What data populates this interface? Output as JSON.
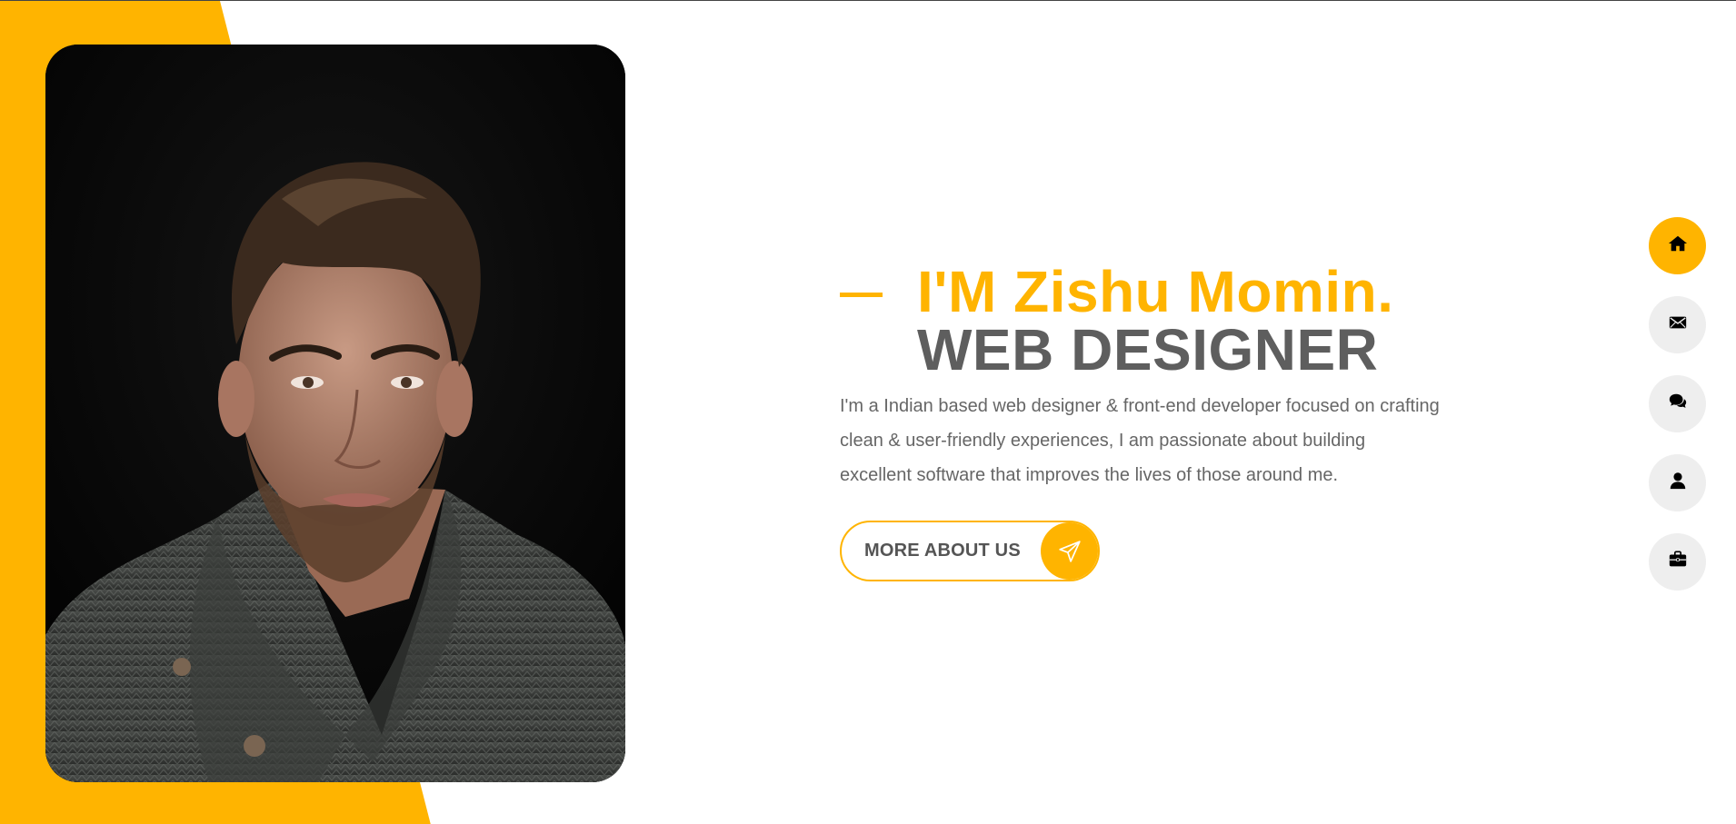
{
  "colors": {
    "accent": "#ffb400",
    "heading_dark": "#5e5e5e",
    "body_text": "#666666",
    "nav_bg": "#eeeeee"
  },
  "hero": {
    "name": "I'M Zishu Momin.",
    "role": "WEB DESIGNER",
    "bio": "I'm a Indian based web designer & front-end developer focused on crafting clean & user-friendly experiences, I am passionate about building excellent software that improves the lives of those around me.",
    "cta_label": "MORE ABOUT US",
    "cta_icon": "paper-plane-icon"
  },
  "side_nav": {
    "items": [
      {
        "icon": "home-icon",
        "active": true
      },
      {
        "icon": "envelope-icon",
        "active": false
      },
      {
        "icon": "chat-icon",
        "active": false
      },
      {
        "icon": "user-icon",
        "active": false
      },
      {
        "icon": "briefcase-icon",
        "active": false
      }
    ]
  }
}
